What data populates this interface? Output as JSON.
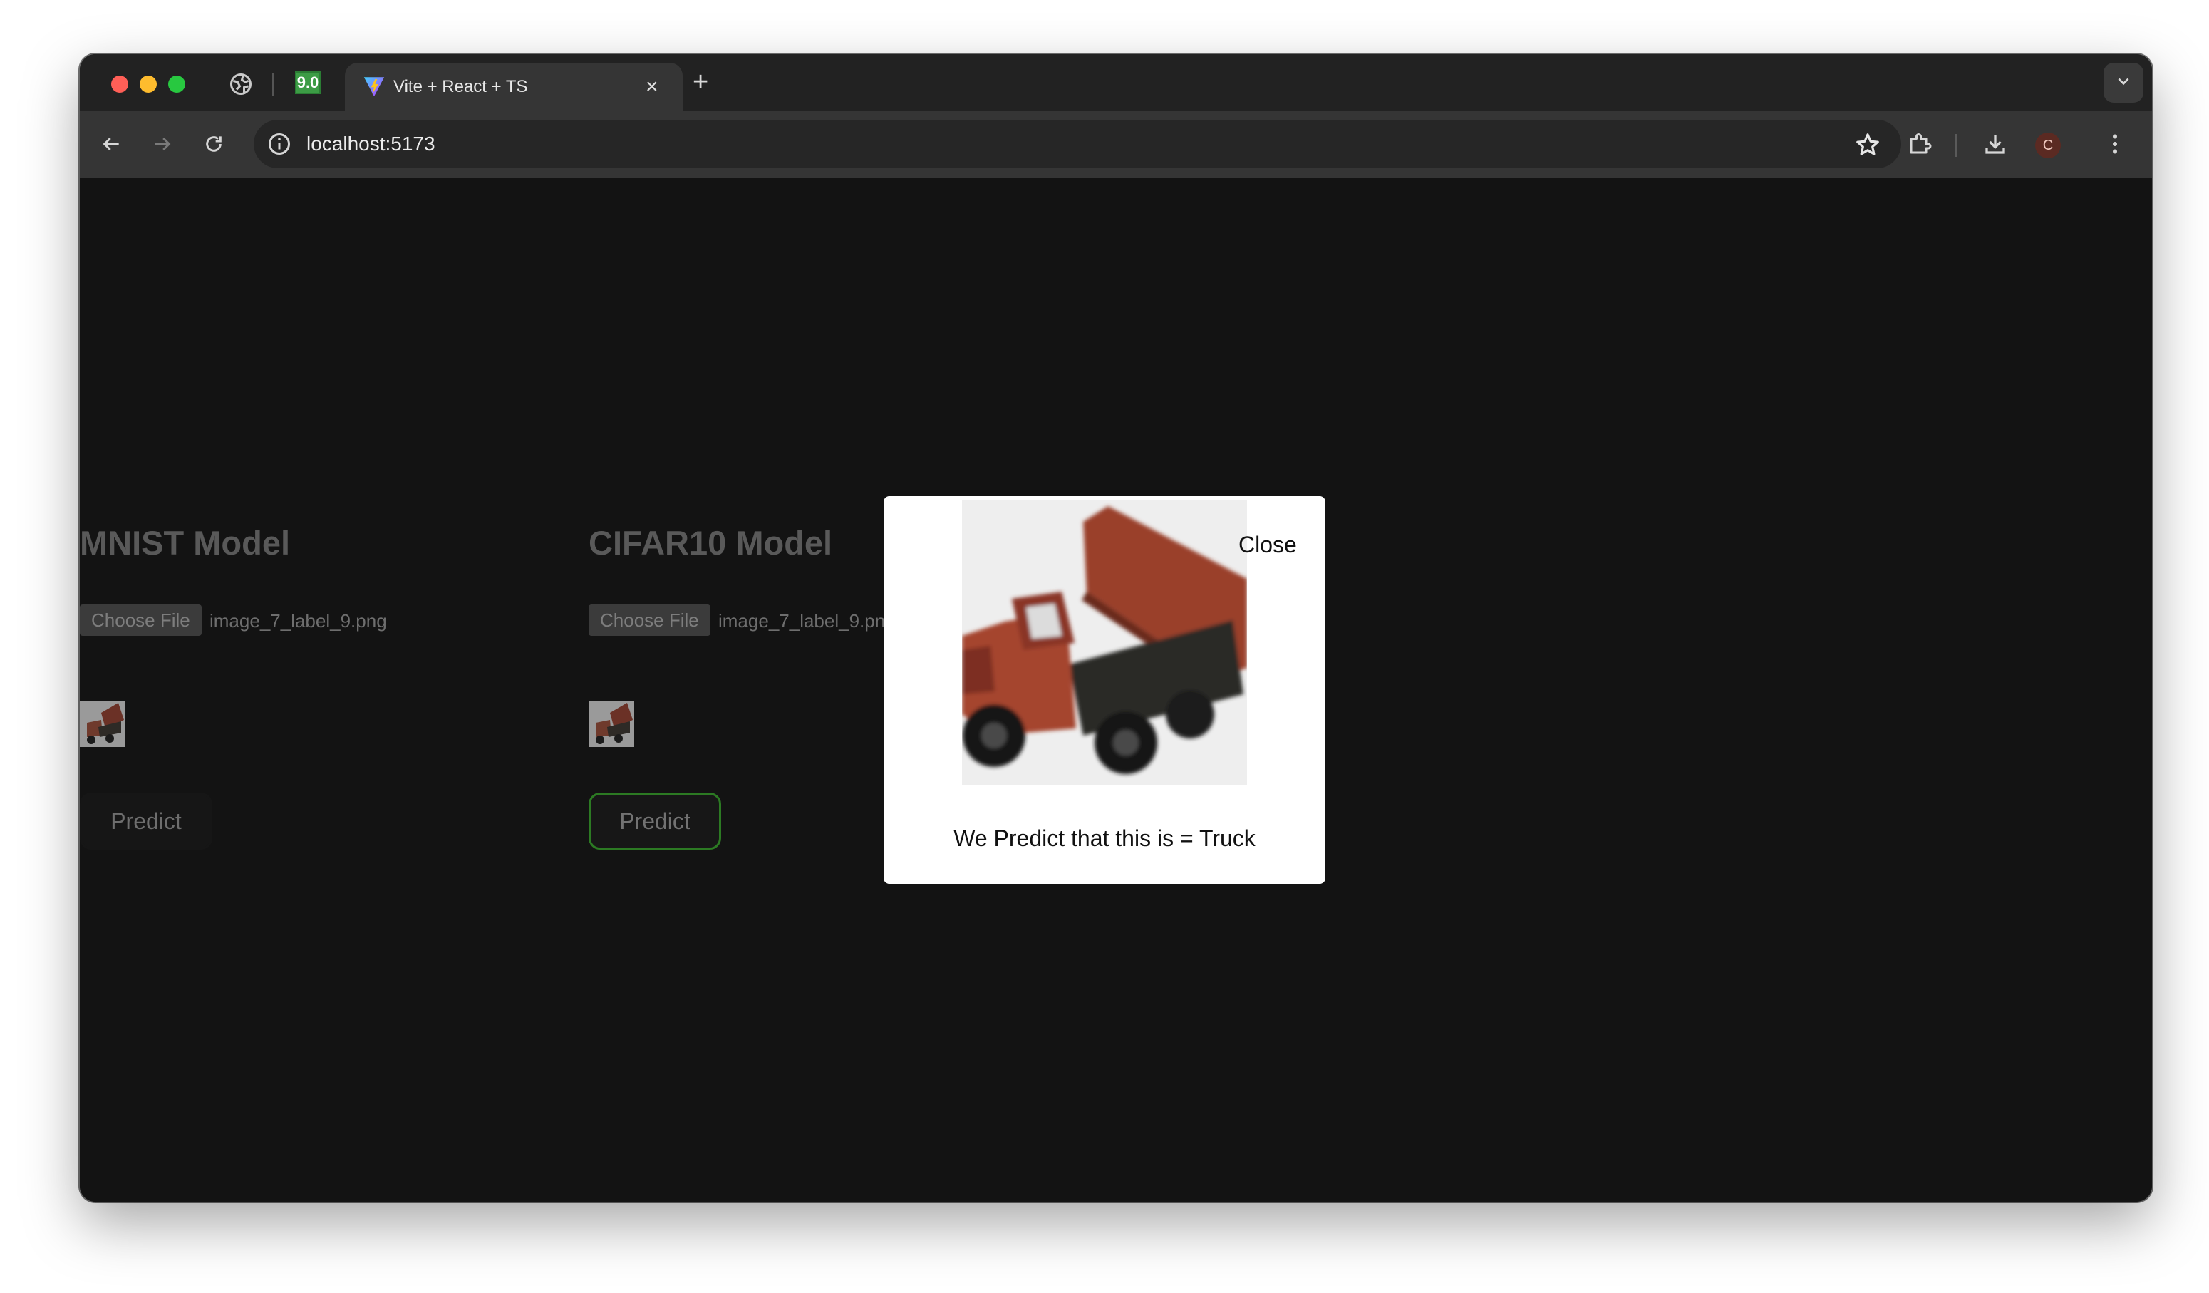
{
  "browser": {
    "pinned_tab_badge": "9.0",
    "active_tab": {
      "title": "Vite + React + TS"
    },
    "address_bar": {
      "url": "localhost:5173"
    },
    "profile_initial": "C"
  },
  "page": {
    "models": [
      {
        "title": "MNIST Model",
        "choose_file_label": "Choose File",
        "file_name": "image_7_label_9.png",
        "predict_label": "Predict"
      },
      {
        "title": "CIFAR10 Model",
        "choose_file_label": "Choose File",
        "file_name": "image_7_label_9.pn",
        "predict_label": "Predict"
      }
    ],
    "modal": {
      "close_label": "Close",
      "result_text": "We Predict that this is = Truck"
    }
  }
}
